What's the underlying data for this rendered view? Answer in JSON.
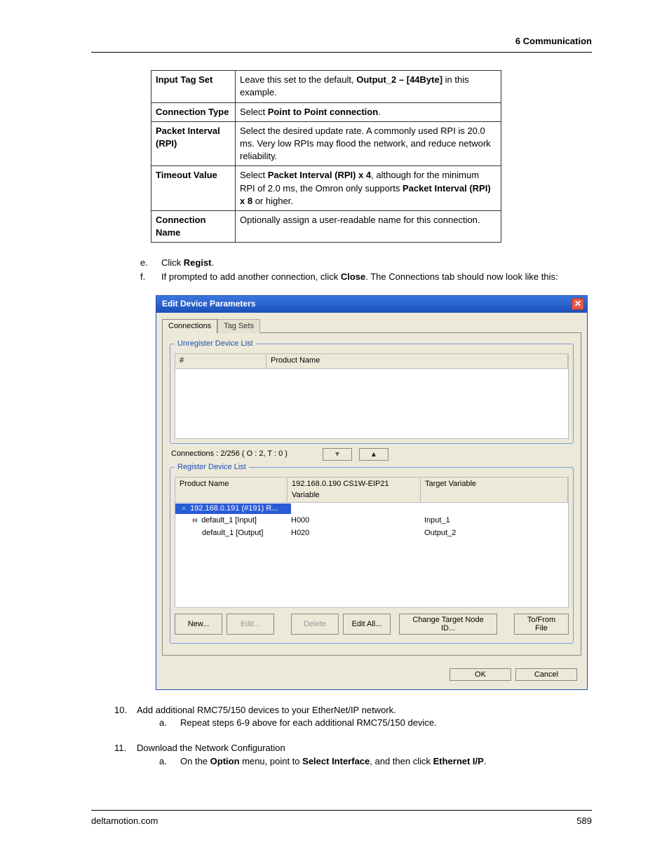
{
  "header": {
    "section": "6  Communication"
  },
  "param_table": [
    {
      "label": "Input Tag Set",
      "desc_parts": [
        "Leave this set to the default, ",
        "Output_2 – [44Byte]",
        " in this example."
      ]
    },
    {
      "label": "Connection Type",
      "desc_parts": [
        "Select ",
        "Point to Point connection",
        "."
      ]
    },
    {
      "label": "Packet Interval (RPI)",
      "desc": "Select the desired update rate. A commonly used RPI is 20.0 ms. Very low RPIs may flood the network, and reduce network reliability."
    },
    {
      "label": "Timeout Value",
      "desc_parts": [
        "Select ",
        "Packet Interval (RPI) x 4",
        ", although for the minimum RPI of 2.0 ms, the Omron only supports ",
        "Packet Interval (RPI) x 8",
        " or higher."
      ]
    },
    {
      "label": "Connection Name",
      "desc": "Optionally assign a user-readable name for this connection."
    }
  ],
  "steps": {
    "e": {
      "idx": "e.",
      "pre": "Click ",
      "bold": "Regist",
      "post": "."
    },
    "f": {
      "idx": "f.",
      "pre": "If prompted to add another connection, click ",
      "bold": "Close",
      "post": ". The Connections tab should now look like this:"
    }
  },
  "dialog": {
    "title": "Edit Device Parameters",
    "tabs": {
      "active": "Connections",
      "inactive": "Tag Sets"
    },
    "unreg": {
      "legend": "Unregister Device List",
      "cols": {
        "c1": "#",
        "c2": "Product Name"
      }
    },
    "mid": {
      "connections": "Connections :  2/256 ( O : 2, T : 0 )"
    },
    "reg": {
      "legend": "Register Device List",
      "cols": {
        "c1": "Product Name",
        "c2": "192.168.0.190 CS1W-EIP21 Variable",
        "c3": "Target Variable"
      },
      "rows": [
        {
          "c1": "192.168.0.191 (#191) R...",
          "c2": "",
          "c3": "",
          "sel": true,
          "icon": "diamond"
        },
        {
          "c1": "    default_1 [Input]",
          "c2": "H000",
          "c3": "Input_1",
          "icon": "tree"
        },
        {
          "c1": "    default_1 [Output]",
          "c2": "H020",
          "c3": "Output_2"
        }
      ]
    },
    "buttons": {
      "new": "New...",
      "edit": "Edit...",
      "delete": "Delete",
      "editall": "Edit All...",
      "change": "Change Target Node ID...",
      "tofrom": "To/From File",
      "ok": "OK",
      "cancel": "Cancel"
    }
  },
  "step10": {
    "idx": "10.",
    "text": "Add additional RMC75/150 devices to your EtherNet/IP network.",
    "sub": {
      "idx": "a.",
      "text": "Repeat steps 6-9 above for each additional RMC75/150 device."
    }
  },
  "step11": {
    "idx": "11.",
    "text": "Download the Network Configuration",
    "sub": {
      "idx": "a.",
      "pre": "On the ",
      "b1": "Option",
      "mid1": " menu, point to ",
      "b2": "Select Interface",
      "mid2": ", and then click ",
      "b3": "Ethernet I/P",
      "post": "."
    }
  },
  "footer": {
    "site": "deltamotion.com",
    "page": "589"
  }
}
